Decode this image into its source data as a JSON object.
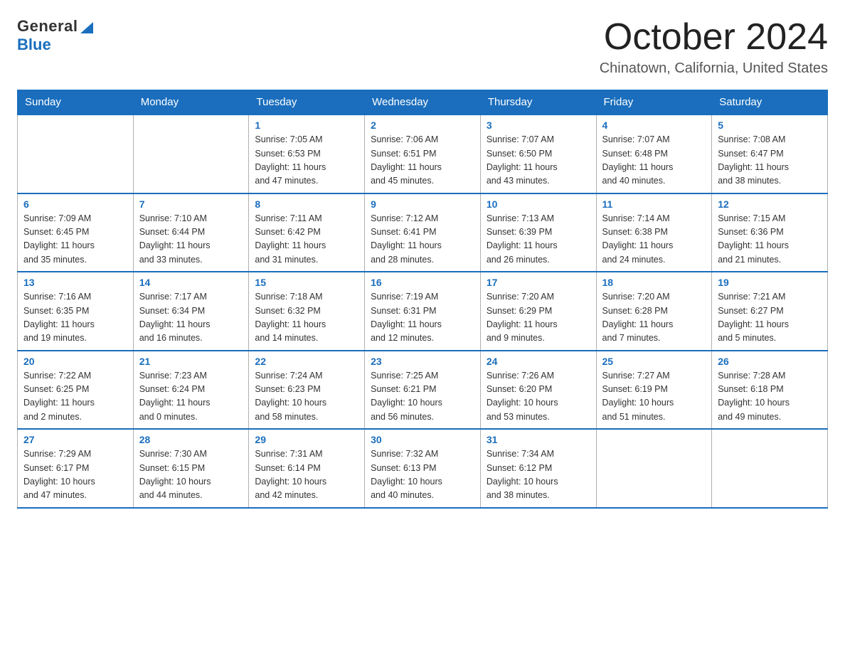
{
  "header": {
    "logo_general": "General",
    "logo_blue": "Blue",
    "month_title": "October 2024",
    "location": "Chinatown, California, United States"
  },
  "weekdays": [
    "Sunday",
    "Monday",
    "Tuesday",
    "Wednesday",
    "Thursday",
    "Friday",
    "Saturday"
  ],
  "weeks": [
    [
      {
        "day": "",
        "info": ""
      },
      {
        "day": "",
        "info": ""
      },
      {
        "day": "1",
        "info": "Sunrise: 7:05 AM\nSunset: 6:53 PM\nDaylight: 11 hours\nand 47 minutes."
      },
      {
        "day": "2",
        "info": "Sunrise: 7:06 AM\nSunset: 6:51 PM\nDaylight: 11 hours\nand 45 minutes."
      },
      {
        "day": "3",
        "info": "Sunrise: 7:07 AM\nSunset: 6:50 PM\nDaylight: 11 hours\nand 43 minutes."
      },
      {
        "day": "4",
        "info": "Sunrise: 7:07 AM\nSunset: 6:48 PM\nDaylight: 11 hours\nand 40 minutes."
      },
      {
        "day": "5",
        "info": "Sunrise: 7:08 AM\nSunset: 6:47 PM\nDaylight: 11 hours\nand 38 minutes."
      }
    ],
    [
      {
        "day": "6",
        "info": "Sunrise: 7:09 AM\nSunset: 6:45 PM\nDaylight: 11 hours\nand 35 minutes."
      },
      {
        "day": "7",
        "info": "Sunrise: 7:10 AM\nSunset: 6:44 PM\nDaylight: 11 hours\nand 33 minutes."
      },
      {
        "day": "8",
        "info": "Sunrise: 7:11 AM\nSunset: 6:42 PM\nDaylight: 11 hours\nand 31 minutes."
      },
      {
        "day": "9",
        "info": "Sunrise: 7:12 AM\nSunset: 6:41 PM\nDaylight: 11 hours\nand 28 minutes."
      },
      {
        "day": "10",
        "info": "Sunrise: 7:13 AM\nSunset: 6:39 PM\nDaylight: 11 hours\nand 26 minutes."
      },
      {
        "day": "11",
        "info": "Sunrise: 7:14 AM\nSunset: 6:38 PM\nDaylight: 11 hours\nand 24 minutes."
      },
      {
        "day": "12",
        "info": "Sunrise: 7:15 AM\nSunset: 6:36 PM\nDaylight: 11 hours\nand 21 minutes."
      }
    ],
    [
      {
        "day": "13",
        "info": "Sunrise: 7:16 AM\nSunset: 6:35 PM\nDaylight: 11 hours\nand 19 minutes."
      },
      {
        "day": "14",
        "info": "Sunrise: 7:17 AM\nSunset: 6:34 PM\nDaylight: 11 hours\nand 16 minutes."
      },
      {
        "day": "15",
        "info": "Sunrise: 7:18 AM\nSunset: 6:32 PM\nDaylight: 11 hours\nand 14 minutes."
      },
      {
        "day": "16",
        "info": "Sunrise: 7:19 AM\nSunset: 6:31 PM\nDaylight: 11 hours\nand 12 minutes."
      },
      {
        "day": "17",
        "info": "Sunrise: 7:20 AM\nSunset: 6:29 PM\nDaylight: 11 hours\nand 9 minutes."
      },
      {
        "day": "18",
        "info": "Sunrise: 7:20 AM\nSunset: 6:28 PM\nDaylight: 11 hours\nand 7 minutes."
      },
      {
        "day": "19",
        "info": "Sunrise: 7:21 AM\nSunset: 6:27 PM\nDaylight: 11 hours\nand 5 minutes."
      }
    ],
    [
      {
        "day": "20",
        "info": "Sunrise: 7:22 AM\nSunset: 6:25 PM\nDaylight: 11 hours\nand 2 minutes."
      },
      {
        "day": "21",
        "info": "Sunrise: 7:23 AM\nSunset: 6:24 PM\nDaylight: 11 hours\nand 0 minutes."
      },
      {
        "day": "22",
        "info": "Sunrise: 7:24 AM\nSunset: 6:23 PM\nDaylight: 10 hours\nand 58 minutes."
      },
      {
        "day": "23",
        "info": "Sunrise: 7:25 AM\nSunset: 6:21 PM\nDaylight: 10 hours\nand 56 minutes."
      },
      {
        "day": "24",
        "info": "Sunrise: 7:26 AM\nSunset: 6:20 PM\nDaylight: 10 hours\nand 53 minutes."
      },
      {
        "day": "25",
        "info": "Sunrise: 7:27 AM\nSunset: 6:19 PM\nDaylight: 10 hours\nand 51 minutes."
      },
      {
        "day": "26",
        "info": "Sunrise: 7:28 AM\nSunset: 6:18 PM\nDaylight: 10 hours\nand 49 minutes."
      }
    ],
    [
      {
        "day": "27",
        "info": "Sunrise: 7:29 AM\nSunset: 6:17 PM\nDaylight: 10 hours\nand 47 minutes."
      },
      {
        "day": "28",
        "info": "Sunrise: 7:30 AM\nSunset: 6:15 PM\nDaylight: 10 hours\nand 44 minutes."
      },
      {
        "day": "29",
        "info": "Sunrise: 7:31 AM\nSunset: 6:14 PM\nDaylight: 10 hours\nand 42 minutes."
      },
      {
        "day": "30",
        "info": "Sunrise: 7:32 AM\nSunset: 6:13 PM\nDaylight: 10 hours\nand 40 minutes."
      },
      {
        "day": "31",
        "info": "Sunrise: 7:34 AM\nSunset: 6:12 PM\nDaylight: 10 hours\nand 38 minutes."
      },
      {
        "day": "",
        "info": ""
      },
      {
        "day": "",
        "info": ""
      }
    ]
  ]
}
